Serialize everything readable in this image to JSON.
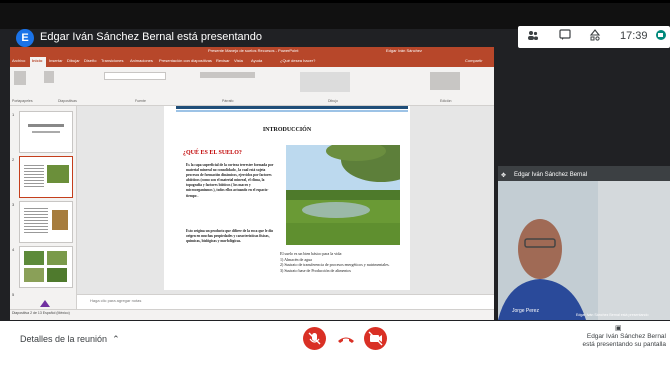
{
  "presenter": {
    "initial": "E",
    "title": "Edgar Iván Sánchez Bernal está presentando"
  },
  "status_panel": {
    "time": "17:39",
    "icons": [
      "people-icon",
      "chat-icon",
      "shapes-icon",
      "more-icon",
      "google-meet-icon"
    ]
  },
  "powerpoint": {
    "window_title": "Presente Manejo de suelos Recursos - PowerPoint",
    "user": "Edgar Iván Sánchez",
    "tabs": [
      "Archivo",
      "Inicio",
      "Insertar",
      "Dibujar",
      "Diseño",
      "Transiciones",
      "Animaciones",
      "Presentación con diapositivas",
      "Revisar",
      "Vista",
      "Ayuda",
      "¿Qué desea hacer?"
    ],
    "share_label": "Compartir",
    "ribbon_groups": [
      "Portapapeles",
      "Diapositivas",
      "Fuente",
      "Párrafo",
      "Dibujo",
      "Edición"
    ],
    "thumb_numbers": [
      "1",
      "2",
      "3",
      "4",
      "5"
    ],
    "notes_placeholder": "Haga clic para agregar notas",
    "statusbar": "Diapositiva 2 de 13  Español (México)"
  },
  "slide": {
    "title": "INTRODUCCIÓN",
    "subtitle": "¿QUÉ ES EL SUELO?",
    "paragraph1": "Es la capa superficial de la corteza terrestre formada por material mineral no consolidado , la cual está sujeta procesos de formación dinámicos, ejercidos por factores abióticos (como son el material mineral, el clima, la topografía y factores bióticos ( los macro y microorganismos ), todos ellos actuando en el espacio-tiempo .",
    "paragraph2": "Esto origina un producto que difiere de la roca que le dio origen en muchas propiedades y características físicas, químicas, biológicas y morfológicas.",
    "list_intro": "El suelo es un bien básico para la vida:",
    "list_items": [
      "1)   Almacén de agua",
      "2)   Sustrato de transferencia de procesos energéticos y nutrimentales.",
      "3)   Sustrato base de Producción de alimentos"
    ]
  },
  "participant": {
    "name": "Edgar Iván Sánchez Bernal",
    "webcam_name": "Jorge Perez",
    "presenting_label": "Edgar Iván Sánchez Bernal está presentando"
  },
  "bottom_bar": {
    "meeting_details": "Detalles de la reunión",
    "present_note": "Edgar Iván Sánchez Bernal está presentando su pantalla",
    "controls": [
      "mic-off-icon",
      "hang-up-icon",
      "camera-off-icon"
    ],
    "accent_color": "#d93025"
  }
}
